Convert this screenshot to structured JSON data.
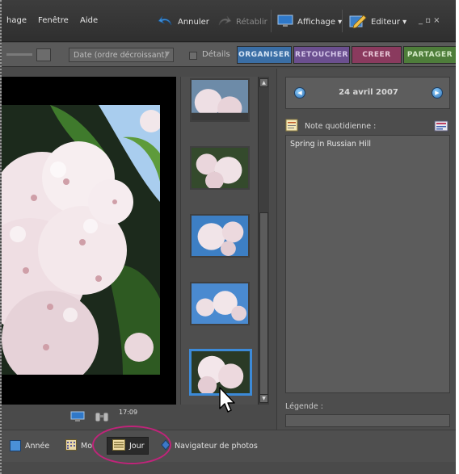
{
  "menu": {
    "items": [
      "hage",
      "Fenêtre",
      "Aide"
    ]
  },
  "toolbar": {
    "undo_label": "Annuler",
    "redo_label": "Rétablir",
    "view_label": "Affichage ▾",
    "editor_label": "Editeur ▾",
    "window_controls": "_ ▫ ×"
  },
  "bar2": {
    "sort_value": "Date (ordre décroissant)",
    "details_label": "Détails",
    "details_checked": false
  },
  "tabs": [
    {
      "label": "ORGANISER",
      "color": "#3a6ea5",
      "text": "#d8e6f5"
    },
    {
      "label": "RETOUCHER",
      "color": "#6b4f8f",
      "text": "#d6c8ea"
    },
    {
      "label": "CREER",
      "color": "#8a3a5e",
      "text": "#e8c7d7"
    },
    {
      "label": "PARTAGER",
      "color": "#4e7d3a",
      "text": "#d5ebc8"
    }
  ],
  "status": {
    "time": "17:09"
  },
  "right_panel": {
    "date": "24 avril 2007",
    "note_label": "Note quotidienne :",
    "note_text": "Spring in Russian Hill",
    "legend_label": "Légende :"
  },
  "bottom_bar": {
    "year_label": "Année",
    "month_label": "Mo",
    "day_label": "Jour",
    "navigator_label": "Navigateur de photos"
  },
  "colors": {
    "accent_blue": "#3c8ad8",
    "highlight_ring": "#c0247a"
  }
}
